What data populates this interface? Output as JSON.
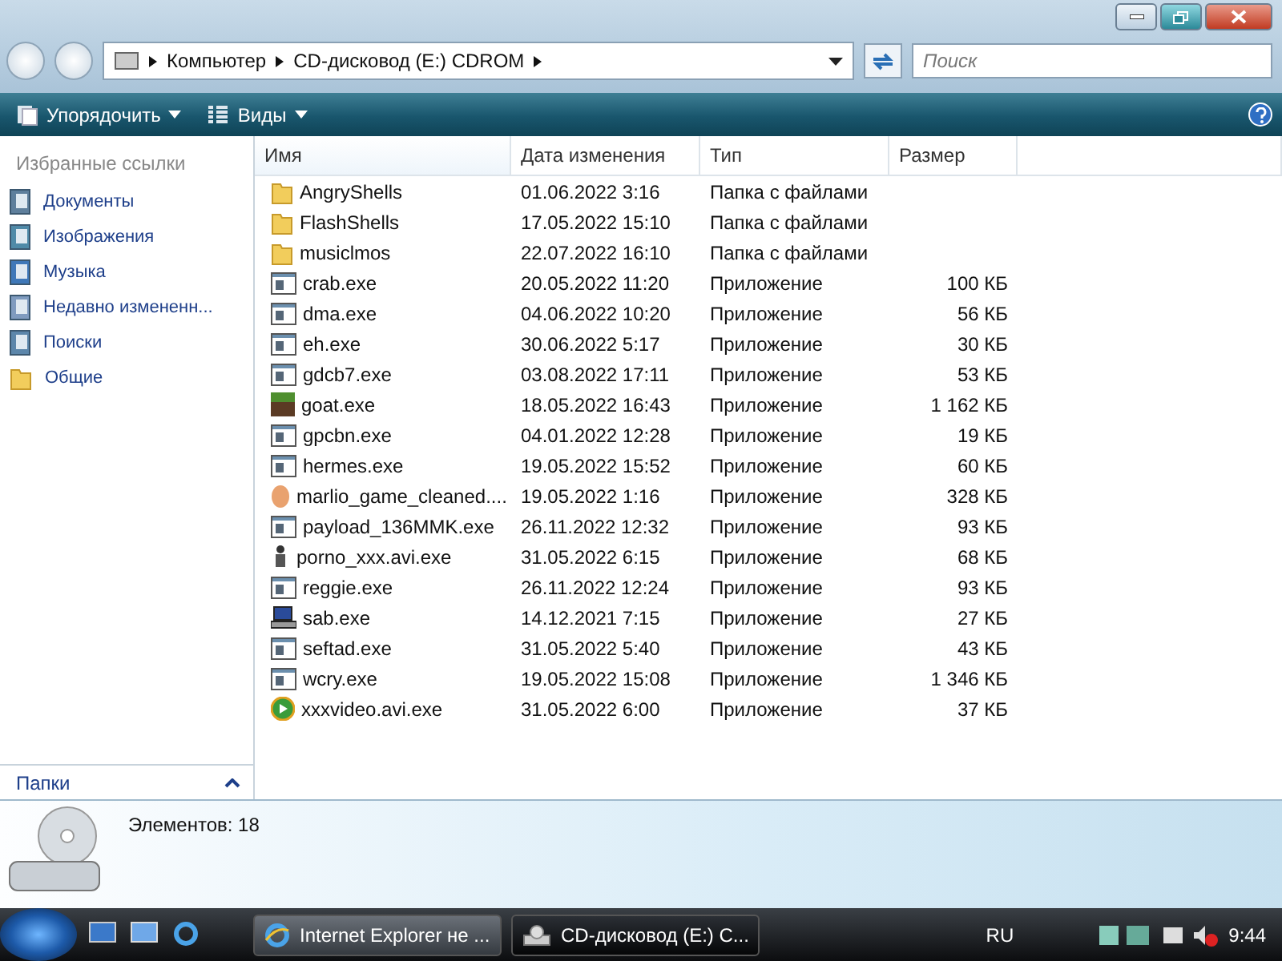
{
  "address": {
    "crumbs": [
      "Компьютер",
      "CD-дисковод (E:) CDROM"
    ]
  },
  "search": {
    "placeholder": "Поиск"
  },
  "toolbar": {
    "buttons": [
      {
        "label": "Упорядочить",
        "kind": "organize"
      },
      {
        "label": "Виды",
        "kind": "views"
      }
    ]
  },
  "sidebar": {
    "title": "Избранные ссылки",
    "items": [
      {
        "label": "Документы",
        "kind": "docs"
      },
      {
        "label": "Изображения",
        "kind": "pictures"
      },
      {
        "label": "Музыка",
        "kind": "music"
      },
      {
        "label": "Недавно измененн...",
        "kind": "recent"
      },
      {
        "label": "Поиски",
        "kind": "searches"
      },
      {
        "label": "Общие",
        "kind": "folder"
      }
    ],
    "folders_label": "Папки"
  },
  "table": {
    "columns": [
      "Имя",
      "Дата изменения",
      "Тип",
      "Размер"
    ],
    "rows": [
      {
        "name": "AngryShells",
        "date": "01.06.2022 3:16",
        "type": "Папка с файлами",
        "kind": "folder"
      },
      {
        "name": "FlashShells",
        "date": "17.05.2022 15:10",
        "type": "Папка с файлами",
        "kind": "folder"
      },
      {
        "name": "musiclmos",
        "date": "22.07.2022 16:10",
        "type": "Папка с файлами",
        "kind": "folder"
      },
      {
        "name": "crab.exe",
        "date": "20.05.2022 11:20",
        "type": "Приложение",
        "size": "100 КБ",
        "kind": "app"
      },
      {
        "name": "dma.exe",
        "date": "04.06.2022 10:20",
        "type": "Приложение",
        "size": "56 КБ",
        "kind": "app"
      },
      {
        "name": "eh.exe",
        "date": "30.06.2022 5:17",
        "type": "Приложение",
        "size": "30 КБ",
        "kind": "app"
      },
      {
        "name": "gdcb7.exe",
        "date": "03.08.2022 17:11",
        "type": "Приложение",
        "size": "53 КБ",
        "kind": "app"
      },
      {
        "name": "goat.exe",
        "date": "18.05.2022 16:43",
        "type": "Приложение",
        "size": "1 162 КБ",
        "kind": "block"
      },
      {
        "name": "gpcbn.exe",
        "date": "04.01.2022 12:28",
        "type": "Приложение",
        "size": "19 КБ",
        "kind": "app"
      },
      {
        "name": "hermes.exe",
        "date": "19.05.2022 15:52",
        "type": "Приложение",
        "size": "60 КБ",
        "kind": "app"
      },
      {
        "name": "marlio_game_cleaned....",
        "date": "19.05.2022 1:16",
        "type": "Приложение",
        "size": "328 КБ",
        "kind": "egg"
      },
      {
        "name": "payload_136MMK.exe",
        "date": "26.11.2022 12:32",
        "type": "Приложение",
        "size": "93 КБ",
        "kind": "app"
      },
      {
        "name": "porno_xxx.avi.exe",
        "date": "31.05.2022 6:15",
        "type": "Приложение",
        "size": "68 КБ",
        "kind": "figure"
      },
      {
        "name": "reggie.exe",
        "date": "26.11.2022 12:24",
        "type": "Приложение",
        "size": "93 КБ",
        "kind": "app"
      },
      {
        "name": "sab.exe",
        "date": "14.12.2021 7:15",
        "type": "Приложение",
        "size": "27 КБ",
        "kind": "computer"
      },
      {
        "name": "seftad.exe",
        "date": "31.05.2022 5:40",
        "type": "Приложение",
        "size": "43 КБ",
        "kind": "app"
      },
      {
        "name": "wcry.exe",
        "date": "19.05.2022 15:08",
        "type": "Приложение",
        "size": "1 346 КБ",
        "kind": "app"
      },
      {
        "name": "xxxvideo.avi.exe",
        "date": "31.05.2022 6:00",
        "type": "Приложение",
        "size": "37 КБ",
        "kind": "media"
      }
    ]
  },
  "details": {
    "count": "Элементов: 18"
  },
  "taskbar": {
    "buttons": [
      {
        "label": "Internet Explorer не ...",
        "selected": false,
        "kind": "ie"
      },
      {
        "label": "CD-дисковод (E:) C...",
        "selected": true,
        "kind": "drive"
      }
    ],
    "language": "RU",
    "clock": "9:44"
  }
}
